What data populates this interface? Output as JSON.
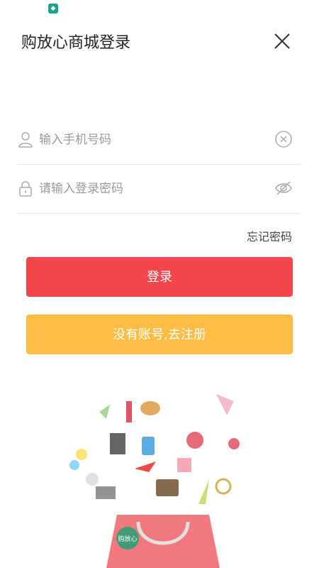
{
  "status_bar": {
    "app_icon": "shield-app-icon"
  },
  "header": {
    "title": "购放心商城登录",
    "close_icon": "close-icon"
  },
  "phone_field": {
    "placeholder": "输入手机号码",
    "value": "",
    "lead_icon": "user-icon",
    "trail_icon": "clear-circle-icon"
  },
  "password_field": {
    "placeholder": "请输入登录密码",
    "value": "",
    "lead_icon": "lock-icon",
    "trail_icon": "eye-hidden-icon"
  },
  "forgot_link": "忘记密码",
  "login_button": {
    "label": "登录",
    "color": "#f2464a"
  },
  "register_button": {
    "label": "没有账号,去注册",
    "color": "#fdbd45"
  },
  "illustration": {
    "bag_text": "购放心"
  }
}
